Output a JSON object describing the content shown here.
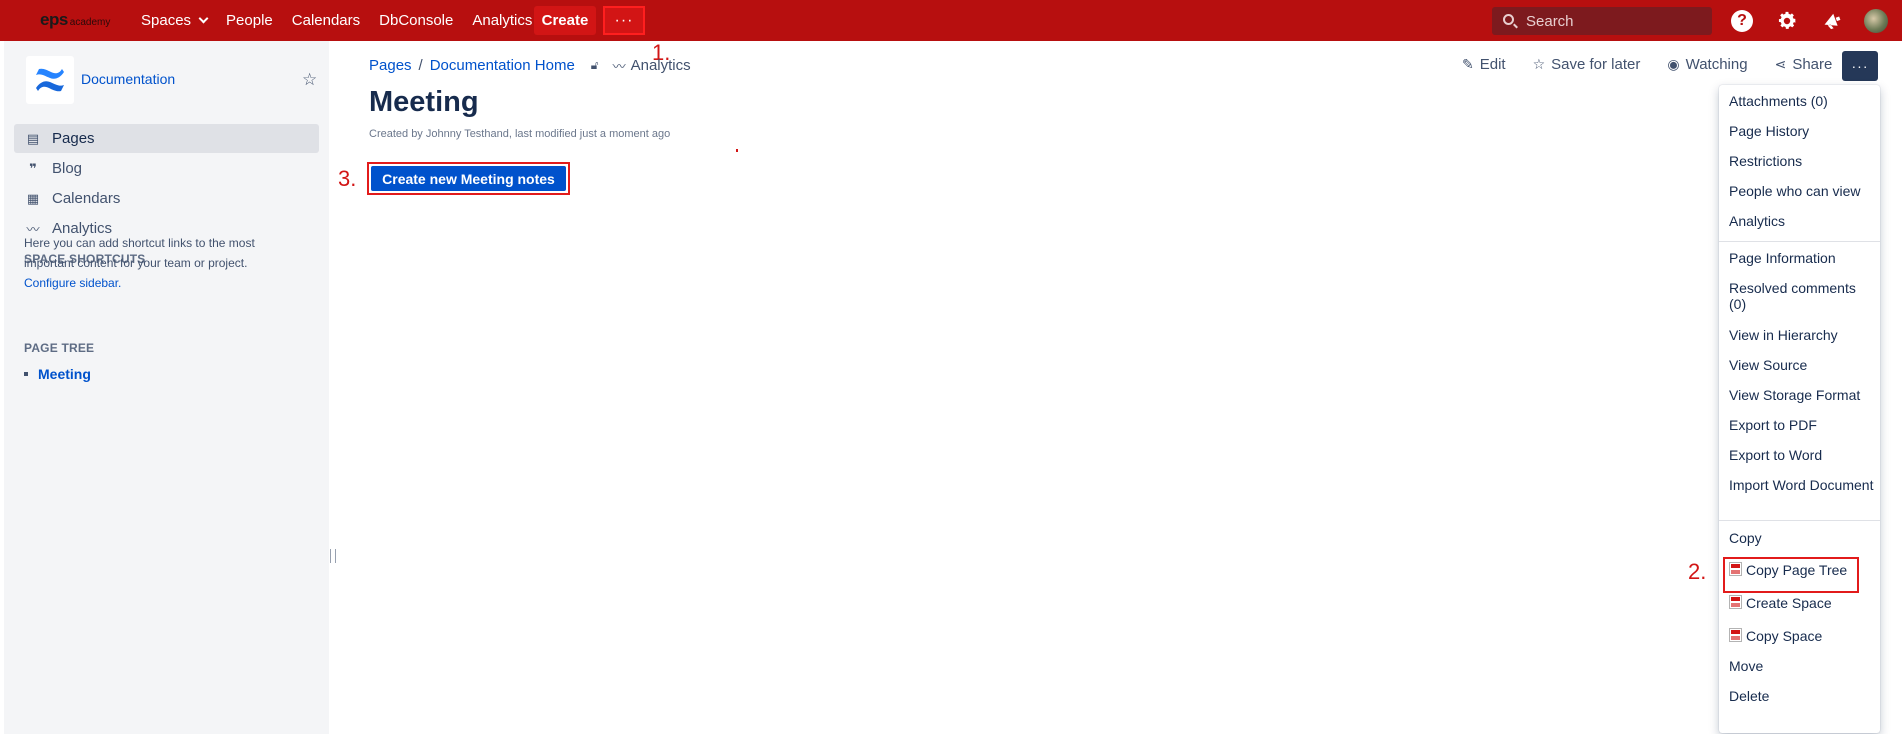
{
  "topnav": {
    "logo_main": "eps",
    "logo_sub": "academy",
    "items": [
      "Spaces",
      "People",
      "Calendars",
      "DbConsole",
      "Analytics"
    ],
    "create_label": "Create",
    "more_label": "···",
    "search_placeholder": "Search"
  },
  "sidebar": {
    "space_name": "Documentation",
    "nav": [
      {
        "label": "Pages",
        "icon": "pages-icon"
      },
      {
        "label": "Blog",
        "icon": "blog-quote-icon"
      },
      {
        "label": "Calendars",
        "icon": "calendar-icon"
      },
      {
        "label": "Analytics",
        "icon": "analytics-icon"
      }
    ],
    "shortcuts_heading": "SPACE SHORTCUTS",
    "shortcuts_text": "Here you can add shortcut links to the most important content for your team or project.",
    "configure_link": "Configure sidebar.",
    "page_tree_heading": "PAGE TREE",
    "page_tree_items": [
      "Meeting"
    ]
  },
  "main": {
    "breadcrumb": [
      "Pages",
      "Documentation Home"
    ],
    "breadcrumb_analytics": "Analytics",
    "title": "Meeting",
    "byline": "Created by Johnny Testhand, last modified just a moment ago",
    "create_notes_label": "Create new Meeting notes"
  },
  "actions": {
    "edit": "Edit",
    "save_later": "Save for later",
    "watching": "Watching",
    "share": "Share",
    "more": "···"
  },
  "dropdown": {
    "group1": [
      "Attachments (0)",
      "Page History",
      "Restrictions",
      "People who can view",
      "Analytics"
    ],
    "group2": [
      "Page Information",
      "Resolved comments (0)",
      "View in Hierarchy",
      "View Source",
      "View Storage Format",
      "Export to PDF",
      "Export to Word",
      "Import Word Document"
    ],
    "group3": [
      "Copy",
      "Copy Page Tree",
      "Create Space",
      "Copy Space",
      "Move",
      "Delete"
    ]
  },
  "annotations": {
    "step1": "1.",
    "step2": "2.",
    "step3": "3."
  },
  "colors": {
    "topbar": "#b70f0f",
    "primary_button": "#0052cc",
    "annotation_red": "#e21b1b"
  }
}
